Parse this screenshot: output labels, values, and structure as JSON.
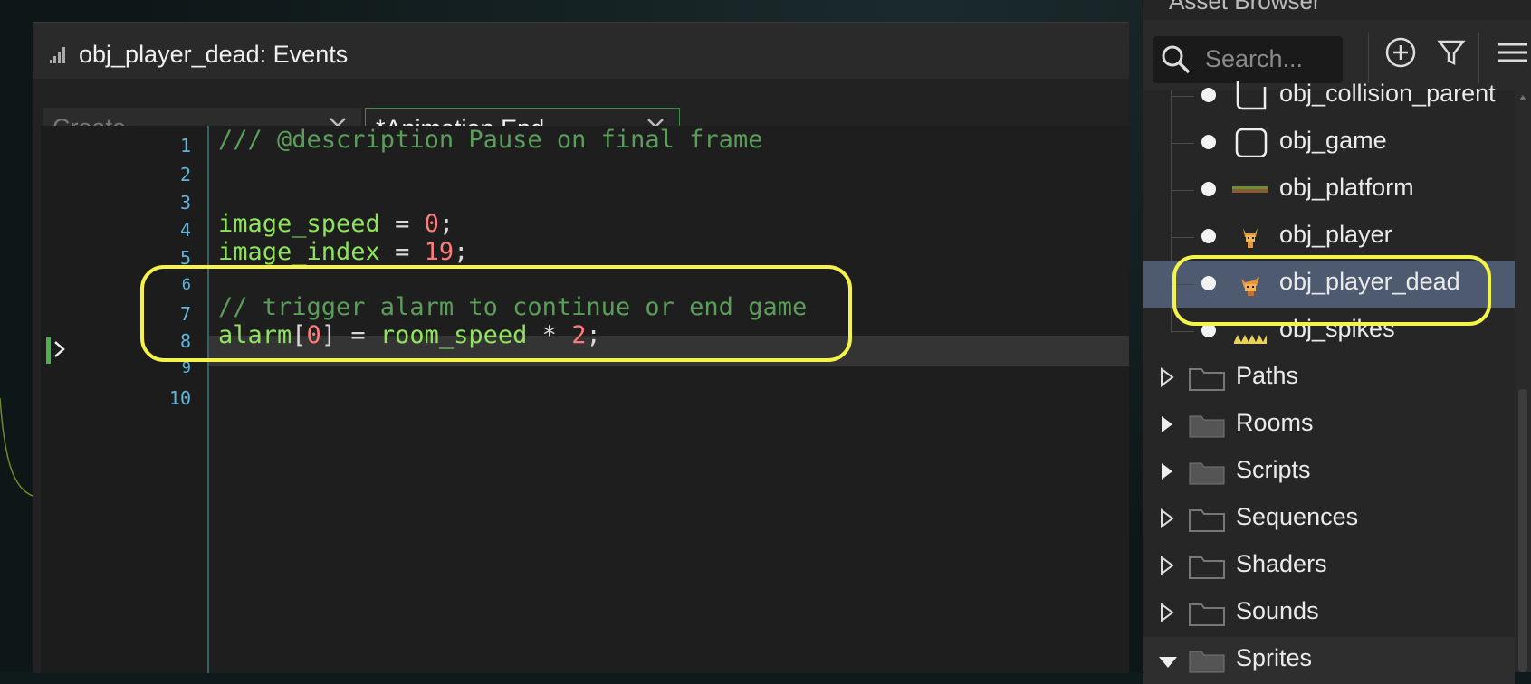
{
  "editor": {
    "title": "obj_player_dead: Events",
    "tabs": [
      {
        "label": "Create",
        "active": false
      },
      {
        "label": "*Animation End",
        "active": true
      }
    ],
    "line_numbers": [
      "1",
      "2",
      "3",
      "4",
      "5",
      "6",
      "7",
      "8",
      "9",
      "10"
    ],
    "code": {
      "l1": "/// @description Pause on final frame",
      "l4_var": "image_speed",
      "l4_op": " = ",
      "l4_num": "0",
      "l4_end": ";",
      "l5_var": "image_index",
      "l5_op": " = ",
      "l5_num": "19",
      "l5_end": ";",
      "l7": "// trigger alarm to continue or end game",
      "l8_var": "alarm",
      "l8_b1": "[",
      "l8_idx": "0",
      "l8_b2": "]",
      "l8_op": " = ",
      "l8_var2": "room_speed",
      "l8_op2": " * ",
      "l8_num": "2",
      "l8_end": ";"
    }
  },
  "asset_browser": {
    "title": "Asset Browser",
    "search_placeholder": "Search...",
    "objects": [
      {
        "name": "obj_collision_parent",
        "thumb": "object-outline-icon"
      },
      {
        "name": "obj_game",
        "thumb": "object-outline-icon"
      },
      {
        "name": "obj_platform",
        "thumb": "platform-sprite-icon"
      },
      {
        "name": "obj_player",
        "thumb": "fox-sprite-icon"
      },
      {
        "name": "obj_player_dead",
        "thumb": "fox-dead-sprite-icon",
        "selected": true
      },
      {
        "name": "obj_spikes",
        "thumb": "spikes-sprite-icon"
      }
    ],
    "folders": [
      {
        "name": "Paths",
        "filled": false,
        "expanded": false
      },
      {
        "name": "Rooms",
        "filled": true,
        "expanded": false
      },
      {
        "name": "Scripts",
        "filled": true,
        "expanded": false
      },
      {
        "name": "Sequences",
        "filled": false,
        "expanded": false
      },
      {
        "name": "Shaders",
        "filled": false,
        "expanded": false
      },
      {
        "name": "Sounds",
        "filled": false,
        "expanded": false
      },
      {
        "name": "Sprites",
        "filled": true,
        "expanded": true
      }
    ]
  },
  "colors": {
    "highlight": "#f5f24a",
    "comment": "#5a9e5a",
    "variable": "#8fe35c",
    "number": "#ff7b7b",
    "line_number": "#5fb7df",
    "selected_row": "#4d5a70"
  }
}
